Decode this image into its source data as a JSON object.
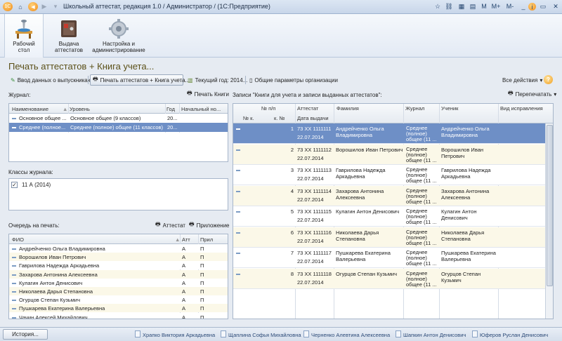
{
  "window": {
    "title": "Школьный аттестат, редакция 1.0 / Администратор /  (1С:Предприятие)",
    "controls": [
      "M",
      "M+",
      "M-"
    ]
  },
  "sections": [
    {
      "label1": "Рабочий",
      "label2": "стол"
    },
    {
      "label1": "Выдача",
      "label2": "аттестатов"
    },
    {
      "label1": "Настройка и",
      "label2": "администрирование"
    }
  ],
  "form": {
    "title": "Печать аттестатов + Книга учета..."
  },
  "toolbar": {
    "enter_data": "Ввод данных о выпускниках",
    "print_book": "Печать аттестатов + Книга учета...",
    "current_year": "Текущий год: 2014...",
    "org_params": "Общие параметры организации",
    "all_actions": "Все действия",
    "help": "?"
  },
  "journal": {
    "label": "Журнал:",
    "print_book_button": "Печать Книги",
    "headers": [
      "Наименование",
      "Уровень",
      "Год",
      "Начальный но..."
    ],
    "rows": [
      {
        "name": "Основное общее ...",
        "level": "Основное общее (9 классов)",
        "year": "20..."
      },
      {
        "name": "Среднее (полное...",
        "level": "Среднее (полное) общее (11 классов)",
        "year": "20..."
      }
    ],
    "selected": 1
  },
  "classes": {
    "label": "Классы журнала:",
    "items": [
      {
        "name": "11 А (2014)",
        "checked": true
      }
    ]
  },
  "queue": {
    "label": "Очередь на печать:",
    "attestat_button": "Аттестат",
    "appendix_button": "Приложение",
    "headers": [
      "ФИО",
      "Атт",
      "Прил"
    ],
    "rows": [
      {
        "fio": "Андрейченко Ольга Владимировна",
        "att": "А",
        "pril": "П"
      },
      {
        "fio": "Ворошилов Иван Петрович",
        "att": "А",
        "pril": "П"
      },
      {
        "fio": "Гаврилова Надежда Аркадьевна",
        "att": "А",
        "pril": "П"
      },
      {
        "fio": "Захарова Антонина Алексеевна",
        "att": "А",
        "pril": "П"
      },
      {
        "fio": "Кулагин Антон Денисович",
        "att": "А",
        "pril": "П"
      },
      {
        "fio": "Николаева Дарья Степановна",
        "att": "А",
        "pril": "П"
      },
      {
        "fio": "Огурцов Степан Кузьмич",
        "att": "А",
        "pril": "П"
      },
      {
        "fio": "Пушкарева Екатерина Валерьевна",
        "att": "А",
        "pril": "П"
      },
      {
        "fio": "Чачин Алексей Михайлович",
        "att": "А",
        "pril": "П"
      }
    ]
  },
  "records": {
    "label": "Записи \"Книги для учета и записи выданных аттестатов\":",
    "reprint_button": "Перепечатать",
    "headers": {
      "num_top": "№ п/п",
      "num_k": "№ к.",
      "k_num": "к. №",
      "attestat": "Аттестат",
      "issue_date": "Дата выдачи",
      "surname": "Фамилия",
      "journal": "Журнал",
      "student": "Ученик",
      "correction": "Вид исправления"
    },
    "rows": [
      {
        "n": "1",
        "att": "73 ХХ 1111111",
        "date": "22.07.2014",
        "fio1": "Андрейченко Ольга",
        "fio2": "Владимировна",
        "j1": "Среднее",
        "j2": "(полное)",
        "j3": "общее (11 ...",
        "s1": "Андрейченко Ольга",
        "s2": "Владимировна"
      },
      {
        "n": "2",
        "att": "73 ХХ 1111112",
        "date": "22.07.2014",
        "fio1": "Ворошилов Иван Петрович",
        "fio2": "",
        "j1": "Среднее",
        "j2": "(полное)",
        "j3": "общее (11 ...",
        "s1": "Ворошилов Иван",
        "s2": "Петрович"
      },
      {
        "n": "3",
        "att": "73 ХХ 1111113",
        "date": "22.07.2014",
        "fio1": "Гаврилова Надежда",
        "fio2": "Аркадьевна",
        "j1": "Среднее",
        "j2": "(полное)",
        "j3": "общее (11 ...",
        "s1": "Гаврилова Надежда",
        "s2": "Аркадьевна"
      },
      {
        "n": "4",
        "att": "73 ХХ 1111114",
        "date": "22.07.2014",
        "fio1": "Захарова Антонина",
        "fio2": "Алексеевна",
        "j1": "Среднее",
        "j2": "(полное)",
        "j3": "общее (11 ...",
        "s1": "Захарова Антонина",
        "s2": "Алексеевна"
      },
      {
        "n": "5",
        "att": "73 ХХ 1111115",
        "date": "22.07.2014",
        "fio1": "Кулагин Антон Денисович",
        "fio2": "",
        "j1": "Среднее",
        "j2": "(полное)",
        "j3": "общее (11 ...",
        "s1": "Кулагин Антон",
        "s2": "Денисович"
      },
      {
        "n": "6",
        "att": "73 ХХ 1111116",
        "date": "22.07.2014",
        "fio1": "Николаева Дарья",
        "fio2": "Степановна",
        "j1": "Среднее",
        "j2": "(полное)",
        "j3": "общее (11 ...",
        "s1": "Николаева Дарья",
        "s2": "Степановна"
      },
      {
        "n": "7",
        "att": "73 ХХ 1111117",
        "date": "22.07.2014",
        "fio1": "Пушкарева Екатерина",
        "fio2": "Валерьевна",
        "j1": "Среднее",
        "j2": "(полное)",
        "j3": "общее (11 ...",
        "s1": "Пушкарева Екатерина",
        "s2": "Валерьевна"
      },
      {
        "n": "8",
        "att": "73 ХХ 1111118",
        "date": "22.07.2014",
        "fio1": "Огурцов Степан Кузьмич",
        "fio2": "",
        "j1": "Среднее",
        "j2": "(полное)",
        "j3": "общее (11 ...",
        "s1": "Огурцов Степан",
        "s2": "Кузьмич"
      }
    ],
    "selected": 0
  },
  "statusbar": {
    "history": "История...",
    "users": [
      "Храпко Виктория Аркадьевна",
      "Щаплина Софья Михайловна",
      "Черненко Алевтина Алексеевна",
      "Шапкин Антон Денисович",
      "Юферов Руслан Денисович"
    ]
  },
  "colors": {
    "selection": "#6e8fc6",
    "title": "#5b5018",
    "row_alt": "#fbf8e8"
  }
}
